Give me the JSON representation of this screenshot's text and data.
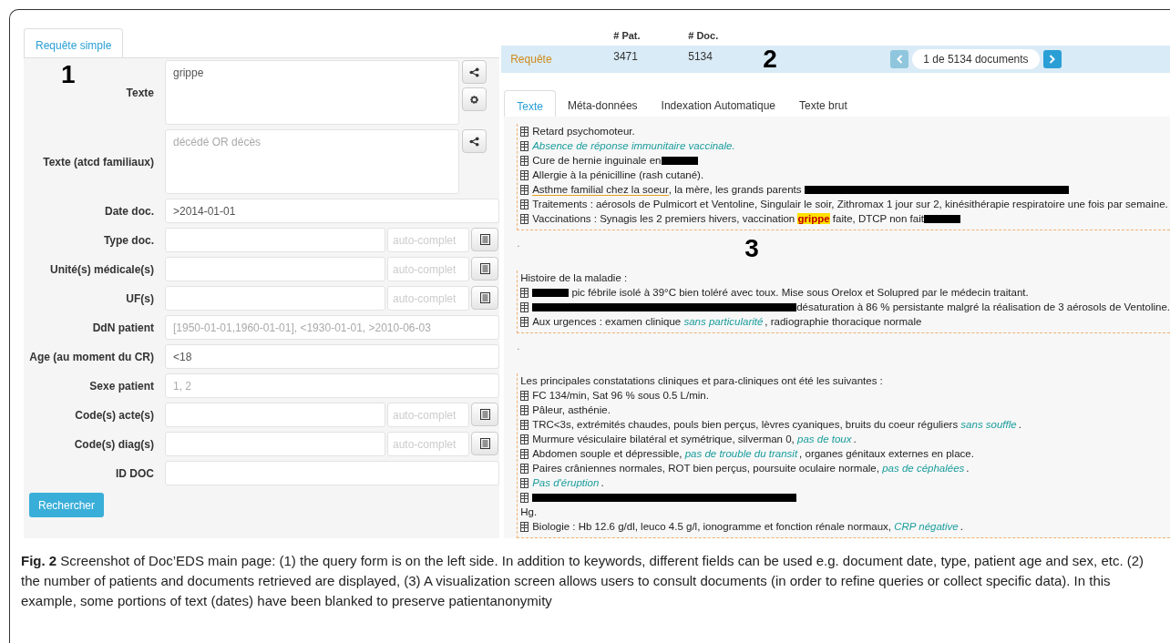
{
  "form": {
    "tab": {
      "label": "Requête simple",
      "selected": true
    },
    "annotation": "1",
    "fields": [
      {
        "kind": "textarea",
        "label": "Texte",
        "value": "grippe",
        "buttons": [
          {
            "kind": "share"
          },
          {
            "kind": "settings"
          }
        ]
      },
      {
        "kind": "textarea",
        "label": "Texte (atcd familiaux)",
        "placeholder": "décédé OR décès",
        "buttons": [
          {
            "kind": "share"
          }
        ]
      },
      {
        "kind": "text",
        "label": "Date doc.",
        "value": ">2014-01-01"
      },
      {
        "kind": "autocomplete",
        "label": "Type doc.",
        "placeholder": "auto-complet"
      },
      {
        "kind": "autocomplete",
        "label": "Unité(s) médicale(s)",
        "placeholder": "auto-complet"
      },
      {
        "kind": "autocomplete",
        "label": "UF(s)",
        "placeholder": "auto-complet"
      },
      {
        "kind": "text",
        "label": "DdN patient",
        "placeholder": "[1950-01-01,1960-01-01], <1930-01-01, >2010-06-03"
      },
      {
        "kind": "text",
        "label": "Age (au moment du CR)",
        "value": "<18"
      },
      {
        "kind": "text",
        "label": "Sexe patient",
        "placeholder": "1, 2"
      },
      {
        "kind": "autocomplete",
        "label": "Code(s) acte(s)",
        "placeholder": "auto-complet"
      },
      {
        "kind": "autocomplete",
        "label": "Code(s) diag(s)",
        "placeholder": "auto-complet"
      },
      {
        "kind": "text",
        "label": "ID DOC"
      }
    ],
    "submit": "Rechercher"
  },
  "results": {
    "columns": [
      "# Pat.",
      "# Doc."
    ],
    "row": {
      "label": "Requête",
      "patients": "3471",
      "documents": "5134"
    },
    "annotation": "2",
    "pager": "1 de 5134 documents"
  },
  "document": {
    "tabs": [
      {
        "label": "Texte",
        "selected": true
      },
      {
        "label": "Méta-données",
        "selected": false
      },
      {
        "label": "Indexation Automatique",
        "selected": false
      },
      {
        "label": "Texte brut",
        "selected": false
      }
    ],
    "annotation": "3",
    "sections": [
      {
        "lines": [
          {
            "kind": "item",
            "segments": [
              {
                "kind": "text",
                "text": "Retard psychomoteur."
              }
            ]
          },
          {
            "kind": "item",
            "segments": [
              {
                "kind": "negation",
                "text": "Absence de réponse immunitaire vaccinale."
              }
            ]
          },
          {
            "kind": "item",
            "segments": [
              {
                "kind": "text",
                "text": "Cure de hernie inguinale en"
              },
              {
                "kind": "redacted"
              }
            ]
          },
          {
            "kind": "item",
            "segments": [
              {
                "kind": "text",
                "text": "Allergie à la pénicilline (rash cutané)."
              }
            ]
          },
          {
            "kind": "item",
            "segments": [
              {
                "kind": "family",
                "text": "Asthme familial chez la soeur"
              },
              {
                "kind": "text",
                "text": ", la mère, les grands parents "
              },
              {
                "kind": "blackout"
              }
            ]
          },
          {
            "kind": "item",
            "segments": [
              {
                "kind": "text",
                "text": "Traitements : aérosols de Pulmicort et Ventoline, Singulair le soir, Zithromax 1 jour sur 2, kinésithérapie respiratoire une fois par semaine."
              }
            ]
          },
          {
            "kind": "item",
            "segments": [
              {
                "kind": "text",
                "text": "Vaccinations : Synagis les 2 premiers hivers, vaccination "
              },
              {
                "kind": "hit",
                "text": "grippe"
              },
              {
                "kind": "text",
                "text": " faite, DTCP non fait"
              },
              {
                "kind": "redacted"
              }
            ]
          }
        ]
      },
      {
        "lead": ".",
        "lines": [
          {
            "kind": "plain",
            "segments": [
              {
                "kind": "text",
                "text": "Histoire de la maladie :"
              }
            ]
          },
          {
            "kind": "item",
            "segments": [
              {
                "kind": "redacted"
              },
              {
                "kind": "text",
                "text": " pic fébrile isolé à 39°C bien toléré avec toux. Mise sous Orelox et Solupred par le médecin traitant."
              }
            ]
          },
          {
            "kind": "item",
            "segments": [
              {
                "kind": "blackout"
              },
              {
                "kind": "text",
                "text": "désaturation à 86 % persistante malgré la réalisation de 3 aérosols de Ventoline."
              }
            ]
          },
          {
            "kind": "item",
            "segments": [
              {
                "kind": "text",
                "text": "Aux urgences : examen clinique "
              },
              {
                "kind": "negation",
                "text": "sans particularité"
              },
              {
                "kind": "text",
                "text": ", radiographie thoracique normale"
              }
            ]
          }
        ]
      },
      {
        "lead": ".",
        "lines": [
          {
            "kind": "plain",
            "segments": [
              {
                "kind": "text",
                "text": "Les principales constatations cliniques et para-cliniques ont été les suivantes :"
              }
            ]
          },
          {
            "kind": "item",
            "segments": [
              {
                "kind": "text",
                "text": "FC 134/min, Sat 96 % sous 0.5 L/min."
              }
            ]
          },
          {
            "kind": "item",
            "segments": [
              {
                "kind": "text",
                "text": "Pâleur, asthénie."
              }
            ]
          },
          {
            "kind": "item",
            "segments": [
              {
                "kind": "text",
                "text": "TRC<3s, extrémités chaudes, pouls bien perçus, lèvres cyaniques, bruits du coeur réguliers "
              },
              {
                "kind": "negation",
                "text": "sans souffle"
              },
              {
                "kind": "text",
                "text": "."
              }
            ]
          },
          {
            "kind": "item",
            "segments": [
              {
                "kind": "text",
                "text": "Murmure vésiculaire bilatéral et symétrique, silverman 0, "
              },
              {
                "kind": "negation",
                "text": "pas de toux"
              },
              {
                "kind": "text",
                "text": "."
              }
            ]
          },
          {
            "kind": "item",
            "segments": [
              {
                "kind": "text",
                "text": "Abdomen souple et dépressible, "
              },
              {
                "kind": "negation",
                "text": "pas de trouble du transit"
              },
              {
                "kind": "text",
                "text": ", organes génitaux externes en place."
              }
            ]
          },
          {
            "kind": "item",
            "segments": [
              {
                "kind": "text",
                "text": "Paires crâniennes normales, ROT bien perçus, poursuite oculaire normale, "
              },
              {
                "kind": "negation",
                "text": "pas de céphalées"
              },
              {
                "kind": "text",
                "text": "."
              }
            ]
          },
          {
            "kind": "item",
            "segments": [
              {
                "kind": "negation",
                "text": "Pas d'éruption"
              },
              {
                "kind": "text",
                "text": "."
              }
            ]
          },
          {
            "kind": "item",
            "segments": [
              {
                "kind": "blackout"
              }
            ]
          },
          {
            "kind": "plain",
            "segments": [
              {
                "kind": "text",
                "text": "Hg."
              }
            ]
          },
          {
            "kind": "item",
            "segments": [
              {
                "kind": "text",
                "text": "Biologie : Hb 12.6 g/dl, leuco 4.5 g/l, ionogramme et fonction rénale normaux, "
              },
              {
                "kind": "negation",
                "text": "CRP négative"
              },
              {
                "kind": "text",
                "text": "."
              }
            ]
          }
        ]
      }
    ]
  },
  "caption": "**Fig. 2**  Screenshot of Doc’EDS main page: (1) the query form is on the left side. In addition to keywords, different fields can be used e.g. document date, type, patient age and sex, etc. (2) the number of patients and documents retrieved are displayed, (3) A visualization screen allows users to consult documents (in order to refine queries or collect specific data). In this example, some portions of text (dates) have been blanked to preserve patientanonymity"
}
